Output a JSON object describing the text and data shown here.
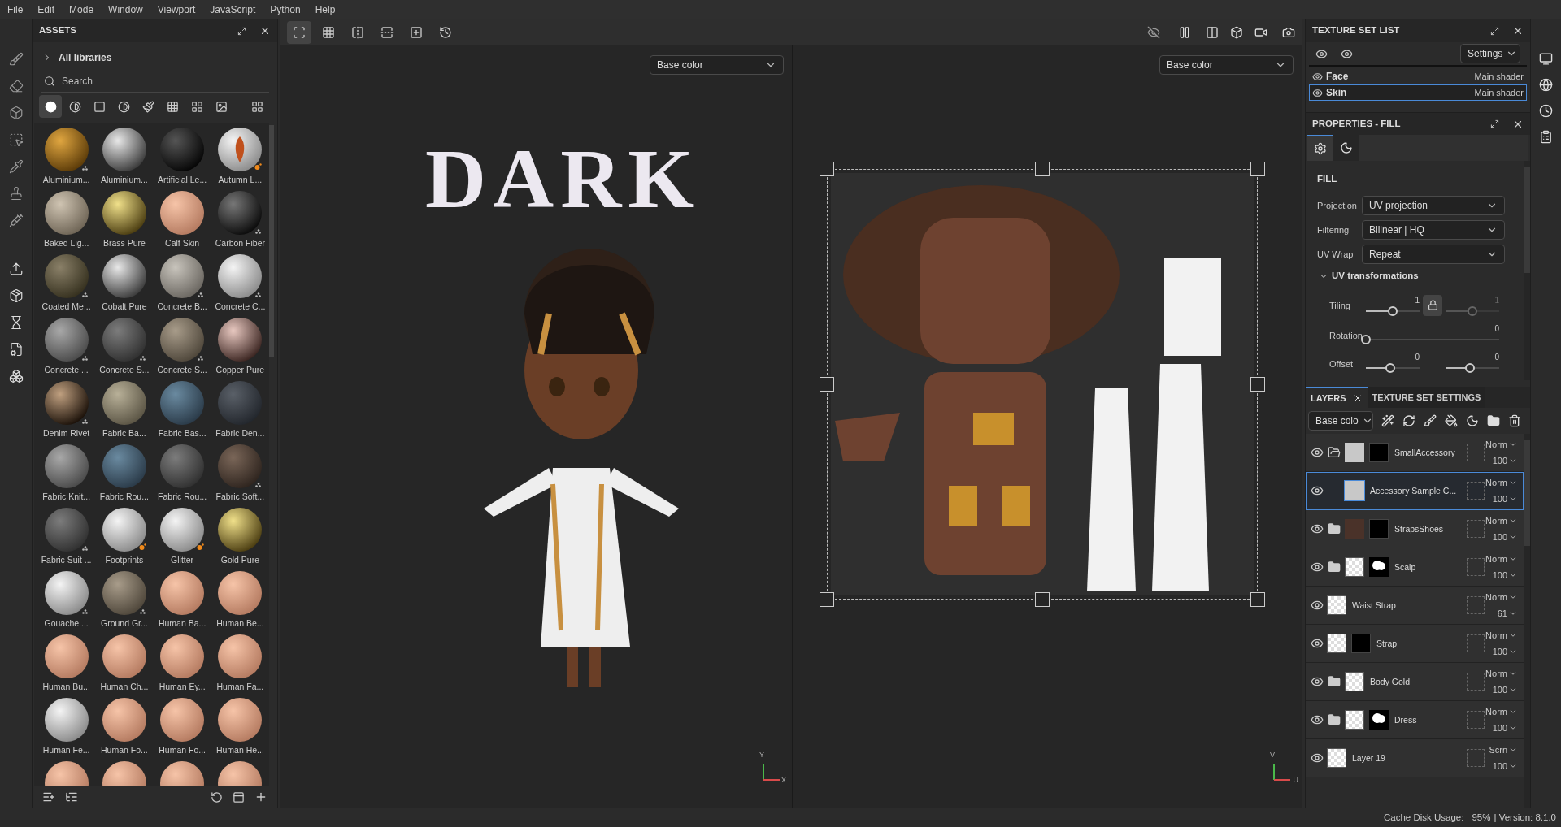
{
  "menu": [
    "File",
    "Edit",
    "Mode",
    "Window",
    "Viewport",
    "JavaScript",
    "Python",
    "Help"
  ],
  "assets": {
    "title": "ASSETS",
    "library": "All libraries",
    "search": {
      "placeholder": "Search"
    },
    "filters": [
      {
        "kind": "material",
        "selected": true
      },
      {
        "kind": "smart",
        "selected": false
      },
      {
        "kind": "mask",
        "selected": false
      },
      {
        "kind": "filter",
        "selected": false
      },
      {
        "kind": "brush",
        "selected": false
      },
      {
        "kind": "alpha",
        "selected": false
      },
      {
        "kind": "texture",
        "selected": false
      },
      {
        "kind": "environment",
        "selected": false
      },
      {
        "kind": "all",
        "selected": false
      }
    ],
    "items": [
      {
        "label": "Aluminium...",
        "kind": "gold",
        "procedural": true
      },
      {
        "label": "Aluminium...",
        "kind": "silver"
      },
      {
        "label": "Artificial Le...",
        "kind": "black"
      },
      {
        "label": "Autumn L...",
        "kind": "leaf",
        "animated": true
      },
      {
        "label": "Baked Lig...",
        "kind": "beige"
      },
      {
        "label": "Brass Pure",
        "kind": "brass"
      },
      {
        "label": "Calf Skin",
        "kind": "skin"
      },
      {
        "label": "Carbon Fiber",
        "kind": "carbon",
        "procedural": true
      },
      {
        "label": "Coated Me...",
        "kind": "olive",
        "procedural": true
      },
      {
        "label": "Cobalt Pure",
        "kind": "silver"
      },
      {
        "label": "Concrete B...",
        "kind": "stone",
        "procedural": true
      },
      {
        "label": "Concrete C...",
        "kind": "white",
        "procedural": true
      },
      {
        "label": "Concrete ...",
        "kind": "grey",
        "procedural": true
      },
      {
        "label": "Concrete S...",
        "kind": "darkgrey",
        "procedural": true
      },
      {
        "label": "Concrete S...",
        "kind": "taupe",
        "procedural": true
      },
      {
        "label": "Copper Pure",
        "kind": "copper"
      },
      {
        "label": "Denim Rivet",
        "kind": "rivet",
        "procedural": true
      },
      {
        "label": "Fabric Ba...",
        "kind": "khaki"
      },
      {
        "label": "Fabric Bas...",
        "kind": "blue"
      },
      {
        "label": "Fabric Den...",
        "kind": "slate"
      },
      {
        "label": "Fabric Knit...",
        "kind": "grey"
      },
      {
        "label": "Fabric Rou...",
        "kind": "blue"
      },
      {
        "label": "Fabric Rou...",
        "kind": "darkgrey"
      },
      {
        "label": "Fabric Soft...",
        "kind": "brown",
        "procedural": true
      },
      {
        "label": "Fabric Suit ...",
        "kind": "darkgrey",
        "procedural": true
      },
      {
        "label": "Footprints",
        "kind": "white",
        "animated": true
      },
      {
        "label": "Glitter",
        "kind": "white",
        "animated": true
      },
      {
        "label": "Gold Pure",
        "kind": "brass"
      },
      {
        "label": "Gouache ...",
        "kind": "white",
        "procedural": true
      },
      {
        "label": "Ground Gr...",
        "kind": "taupe",
        "procedural": true
      },
      {
        "label": "Human Ba...",
        "kind": "skin"
      },
      {
        "label": "Human Be...",
        "kind": "skin"
      },
      {
        "label": "Human Bu...",
        "kind": "skin"
      },
      {
        "label": "Human Ch...",
        "kind": "skin"
      },
      {
        "label": "Human Ey...",
        "kind": "skin"
      },
      {
        "label": "Human Fa...",
        "kind": "skin"
      },
      {
        "label": "Human Fe...",
        "kind": "white"
      },
      {
        "label": "Human Fo...",
        "kind": "skin"
      },
      {
        "label": "Human Fo...",
        "kind": "skin"
      },
      {
        "label": "Human He...",
        "kind": "skin"
      },
      {
        "kind": "skin"
      },
      {
        "kind": "skin"
      },
      {
        "kind": "skin"
      },
      {
        "kind": "skin"
      }
    ]
  },
  "viewport": {
    "tools": [
      {
        "kind": "frame",
        "selected": true
      },
      {
        "kind": "grid",
        "selected": false
      },
      {
        "kind": "mirror-x",
        "selected": false
      },
      {
        "kind": "mirror-y",
        "selected": false
      },
      {
        "kind": "add",
        "selected": false
      },
      {
        "kind": "reset",
        "selected": false
      }
    ],
    "view_3d": {
      "channel": "Base color",
      "title": "DARK",
      "axes": [
        "Y",
        "X"
      ]
    },
    "view_2d": {
      "channel": "Base color",
      "axes": [
        "V",
        "U"
      ]
    }
  },
  "texture_set_list": {
    "title": "TEXTURE SET LIST",
    "settings": "Settings",
    "sets": [
      {
        "name": "Face",
        "shader": "Main shader",
        "selected": false
      },
      {
        "name": "Skin",
        "shader": "Main shader",
        "selected": true
      }
    ]
  },
  "properties": {
    "title": "PROPERTIES - FILL",
    "tabs": [
      {
        "kind": "settings",
        "selected": true
      },
      {
        "kind": "material",
        "selected": false
      }
    ],
    "section": "FILL",
    "fields": [
      {
        "label": "Projection",
        "value": "UV projection"
      },
      {
        "label": "Filtering",
        "value": "Bilinear | HQ"
      },
      {
        "label": "UV Wrap",
        "value": "Repeat"
      }
    ],
    "uv_transformations": {
      "label": "UV transformations",
      "expanded": true,
      "tiling": {
        "label": "Tiling",
        "values": [
          {
            "reading": "1",
            "level": 0.5,
            "disabled": false
          },
          {
            "reading": "1",
            "level": 0.5,
            "disabled": true
          }
        ]
      },
      "rotation": {
        "label": "Rotation",
        "reading": "0",
        "level": 0
      },
      "offset": {
        "label": "Offset",
        "values": [
          {
            "reading": "0",
            "level": 0.45,
            "disabled": false
          },
          {
            "reading": "0",
            "level": 0.45,
            "disabled": false
          }
        ]
      }
    }
  },
  "layers": {
    "tabs": [
      {
        "label": "LAYERS",
        "selected": true
      },
      {
        "label": "TEXTURE SET SETTINGS",
        "selected": false
      }
    ],
    "channel": "Base colo",
    "items": [
      {
        "name": "SmallAccessory",
        "kind": "folder",
        "expanded": true,
        "thumb": {
          "kind": "solid"
        },
        "mask": {
          "kind": "dark"
        },
        "blend": "Norm",
        "opacity": "100",
        "selected": false,
        "children": [
          {
            "name": "Accessory Sample C...",
            "kind": "fill",
            "thumb": {
              "kind": "solid"
            },
            "blend": "Norm",
            "opacity": "100",
            "selected": true
          }
        ]
      },
      {
        "name": "StrapsShoes",
        "kind": "folder",
        "expanded": false,
        "thumb": {
          "kind": "brown"
        },
        "mask": {
          "kind": "dark"
        },
        "blend": "Norm",
        "opacity": "100",
        "selected": false
      },
      {
        "name": "Scalp",
        "kind": "folder",
        "expanded": false,
        "thumb": {
          "kind": "checker"
        },
        "mask": {
          "kind": "blob"
        },
        "blend": "Norm",
        "opacity": "100",
        "selected": false
      },
      {
        "name": "Waist Strap",
        "kind": "layer",
        "thumb": {
          "kind": "checker"
        },
        "blend": "Norm",
        "opacity": "61",
        "selected": false
      },
      {
        "name": "Strap",
        "kind": "layer",
        "thumb": {
          "kind": "checker"
        },
        "mask": {
          "kind": "dark"
        },
        "blend": "Norm",
        "opacity": "100",
        "selected": false
      },
      {
        "name": "Body Gold",
        "kind": "folder",
        "expanded": false,
        "thumb": {
          "kind": "checker"
        },
        "blend": "Norm",
        "opacity": "100",
        "selected": false
      },
      {
        "name": "Dress",
        "kind": "folder",
        "expanded": false,
        "thumb": {
          "kind": "checker"
        },
        "mask": {
          "kind": "blob"
        },
        "blend": "Norm",
        "opacity": "100",
        "selected": false
      },
      {
        "name": "Layer 19",
        "kind": "layer",
        "thumb": {
          "kind": "checker"
        },
        "blend": "Scrn",
        "opacity": "100",
        "selected": false
      }
    ]
  },
  "status_bar": {
    "cache": "Cache Disk Usage:",
    "usage": "95%",
    "version": "| Version: 8.1.0"
  }
}
